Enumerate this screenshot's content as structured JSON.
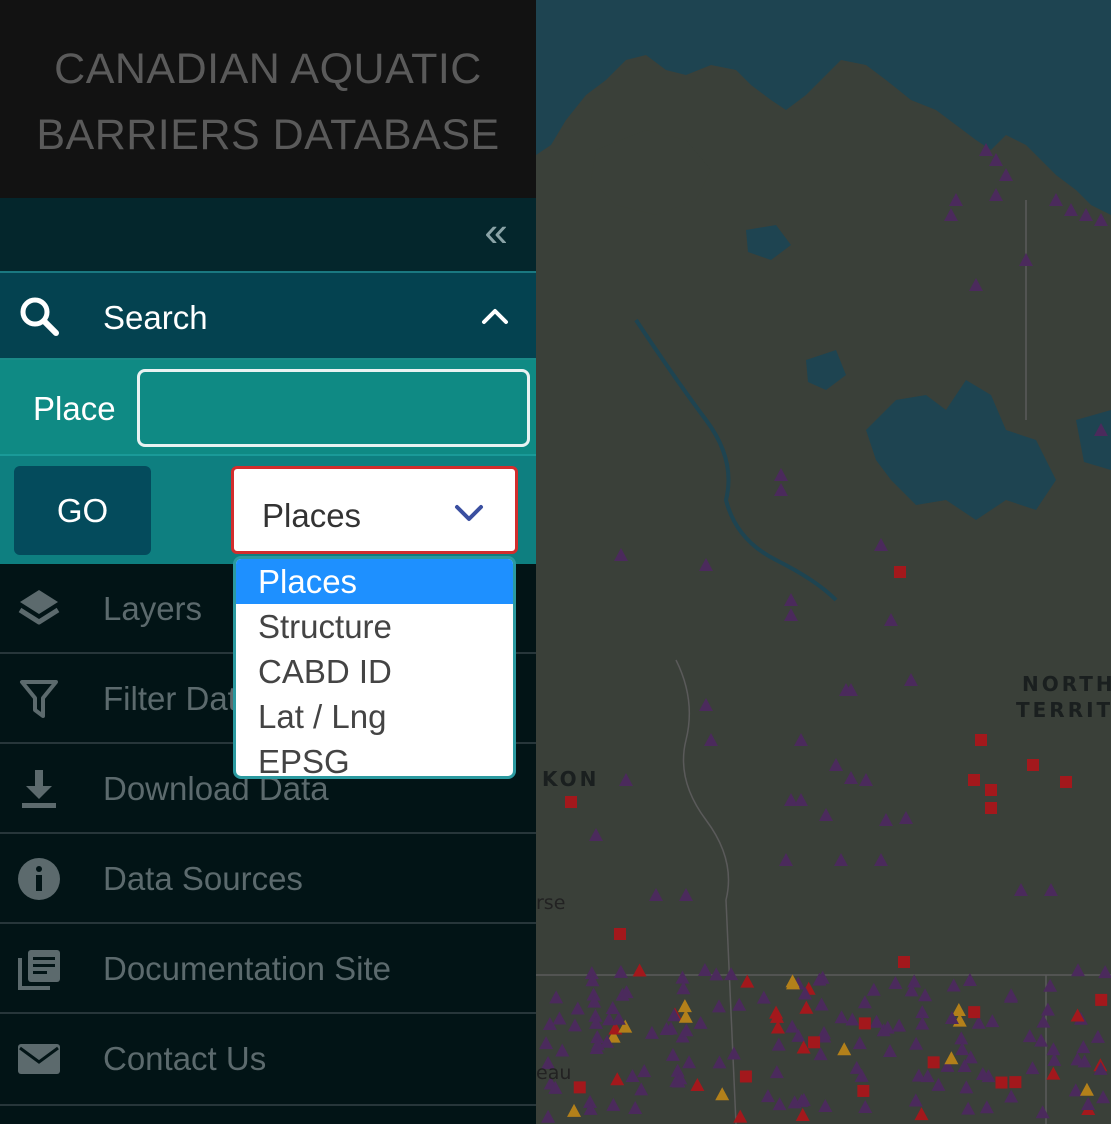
{
  "app": {
    "title_line1": "CANADIAN AQUATIC",
    "title_line2": "BARRIERS DATABASE"
  },
  "sidebar": {
    "collapse_glyph": "«",
    "search": {
      "label": "Search",
      "icon": "search-icon",
      "expanded": true
    },
    "place": {
      "label": "Place",
      "value": "",
      "placeholder": ""
    },
    "go_label": "GO",
    "mode_select": {
      "value": "Places",
      "options": [
        "Places",
        "Structure",
        "CABD ID",
        "Lat / Lng",
        "EPSG"
      ]
    },
    "nav": [
      {
        "label": "Layers",
        "icon": "layers-icon"
      },
      {
        "label": "Filter Data",
        "icon": "filter-icon"
      },
      {
        "label": "Download Data",
        "icon": "download-icon"
      },
      {
        "label": "Data Sources",
        "icon": "info-icon"
      },
      {
        "label": "Documentation Site",
        "icon": "documentation-icon"
      },
      {
        "label": "Contact Us",
        "icon": "mail-icon"
      }
    ]
  },
  "map": {
    "labels": {
      "territory_line1": "NORTHW",
      "territory_line2": "TERRITO",
      "yukon": "KON",
      "city_whitehorse": "rse",
      "city_juneau": "eau"
    },
    "colors": {
      "dam": "#4b2a5c",
      "barrier": "#a3181c",
      "waterfall": "#b3801a",
      "water": "#1e4451",
      "land": "#3a4039"
    }
  },
  "colors": {
    "accent": "#0f8a84",
    "header_bg": "#121212",
    "select_border": "#d22d2d",
    "highlight": "#1e90ff"
  }
}
